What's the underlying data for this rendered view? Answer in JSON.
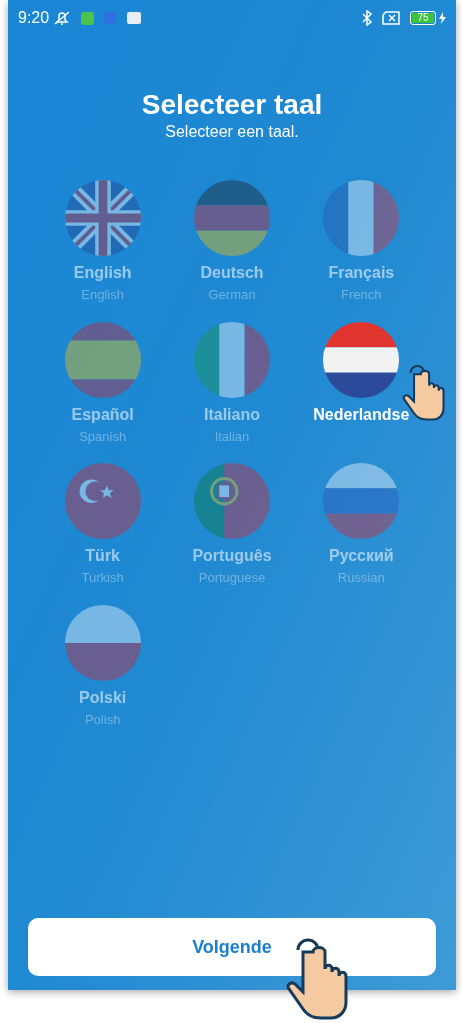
{
  "status_bar": {
    "time": "9:20",
    "battery": "75"
  },
  "title": "Selecteer taal",
  "subtitle": "Selecteer een taal.",
  "languages": [
    {
      "kind": "uk",
      "name": "English",
      "english": "English",
      "selected": false
    },
    {
      "kind": "de",
      "name": "Deutsch",
      "english": "German",
      "selected": false
    },
    {
      "kind": "fr",
      "name": "Français",
      "english": "French",
      "selected": false
    },
    {
      "kind": "es",
      "name": "Español",
      "english": "Spanish",
      "selected": false
    },
    {
      "kind": "it",
      "name": "Italiano",
      "english": "Italian",
      "selected": false
    },
    {
      "kind": "nl",
      "name": "Nederlandse",
      "selected": true
    },
    {
      "kind": "tr",
      "name": "Türk",
      "english": "Turkish",
      "selected": false
    },
    {
      "kind": "pt",
      "name": "Português",
      "english": "Portuguese",
      "selected": false
    },
    {
      "kind": "ru",
      "name": "Русский",
      "english": "Russian",
      "selected": false
    },
    {
      "kind": "pl",
      "name": "Polski",
      "english": "Polish",
      "selected": false
    }
  ],
  "next_button": "Volgende"
}
